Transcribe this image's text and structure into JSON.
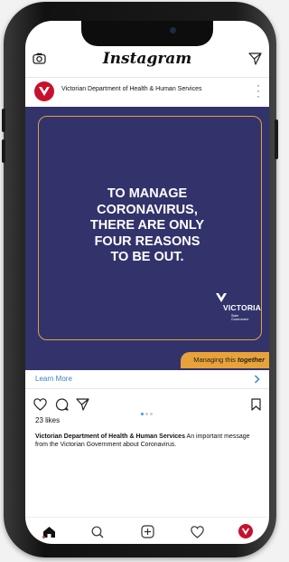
{
  "app": {
    "title": "Instagram"
  },
  "post": {
    "author": "Victorian Department of Health & Human Services",
    "headline_lines": [
      "TO MANAGE",
      "CORONAVIRUS,",
      "THERE ARE ONLY",
      "FOUR REASONS",
      "TO BE OUT."
    ],
    "logo_text": "VICTORIA",
    "logo_sub": "State Government",
    "banner_prefix": "Managing this ",
    "banner_emphasis": "together",
    "cta_label": "Learn More",
    "likes": "23 likes",
    "caption_author": "Victorian Department of Health & Human Services",
    "caption_text": " An important message from the Victorian Government about Coronavirus.",
    "carousel_total": 3,
    "carousel_active": 1
  },
  "icons": {
    "top": [
      "camera-icon",
      "direct-message-icon"
    ],
    "actions": [
      "heart-icon",
      "comment-icon",
      "share-icon",
      "bookmark-icon"
    ],
    "tabbar": [
      "home-icon",
      "search-icon",
      "add-post-icon",
      "activity-heart-icon",
      "profile-avatar-icon"
    ]
  },
  "colors": {
    "brand_red": "#c8102e",
    "media_bg": "#32336b",
    "accent_orange": "#e8a23a",
    "link_blue": "#3b82c4"
  }
}
